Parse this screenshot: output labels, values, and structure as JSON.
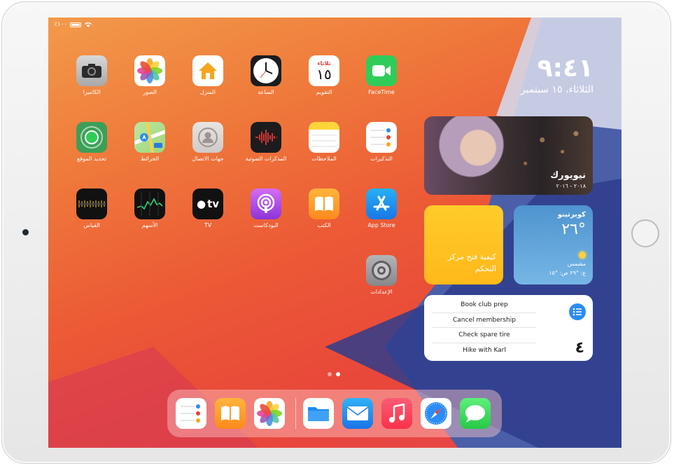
{
  "status_bar": {
    "battery": "٪١٠٠"
  },
  "clock": {
    "time": "٩:٤١",
    "date": "الثلاثاء، ١٥ سبتمبر"
  },
  "apps": [
    {
      "label": "FaceTime",
      "icon": "facetime-icon"
    },
    {
      "label": "التقويم",
      "icon": "calendar-icon",
      "weekday": "ثلاثاء",
      "day": "١٥"
    },
    {
      "label": "الساعة",
      "icon": "clock-icon"
    },
    {
      "label": "المنزل",
      "icon": "home-icon"
    },
    {
      "label": "الصور",
      "icon": "photos-icon"
    },
    {
      "label": "الكاميرا",
      "icon": "camera-icon"
    },
    {
      "label": "التذكيرات",
      "icon": "reminders-icon"
    },
    {
      "label": "الملاحظات",
      "icon": "notes-icon"
    },
    {
      "label": "المذكرات الصوتية",
      "icon": "voice-memos-icon"
    },
    {
      "label": "جهات الاتصال",
      "icon": "contacts-icon"
    },
    {
      "label": "الخرائط",
      "icon": "maps-icon"
    },
    {
      "label": "تحديد الموقع",
      "icon": "find-my-icon"
    },
    {
      "label": "App Store",
      "icon": "app-store-icon"
    },
    {
      "label": "الكتب",
      "icon": "books-icon"
    },
    {
      "label": "البودكاست",
      "icon": "podcasts-icon"
    },
    {
      "label": "TV",
      "icon": "tv-icon",
      "icon_text": "tv"
    },
    {
      "label": "الأسهم",
      "icon": "stocks-icon"
    },
    {
      "label": "القياس",
      "icon": "measure-icon"
    },
    {
      "label": "الإعدادات",
      "icon": "settings-icon"
    }
  ],
  "widgets": {
    "photo": {
      "title": "نيويورك",
      "date": "٢٠١٨ - ٢٠١٦"
    },
    "tips": {
      "text": "كيفية فتح مركز التحكم"
    },
    "weather": {
      "city": "كوبرتينو",
      "temp": "°٢٦",
      "condition": "مشمس",
      "range": "ع: °٢٩ ص: °١٥"
    },
    "reminders": {
      "count": "٤",
      "items": [
        "Book club prep",
        "Cancel membership",
        "Check spare tire",
        "Hike with Karl"
      ]
    }
  },
  "page_indicator": {
    "pages": 2,
    "current": 2
  },
  "dock": [
    {
      "icon": "reminders-icon"
    },
    {
      "icon": "books-icon"
    },
    {
      "icon": "photos-icon"
    },
    {
      "icon": "files-icon"
    },
    {
      "icon": "mail-icon"
    },
    {
      "icon": "music-icon"
    },
    {
      "icon": "safari-icon"
    },
    {
      "icon": "messages-icon"
    }
  ]
}
